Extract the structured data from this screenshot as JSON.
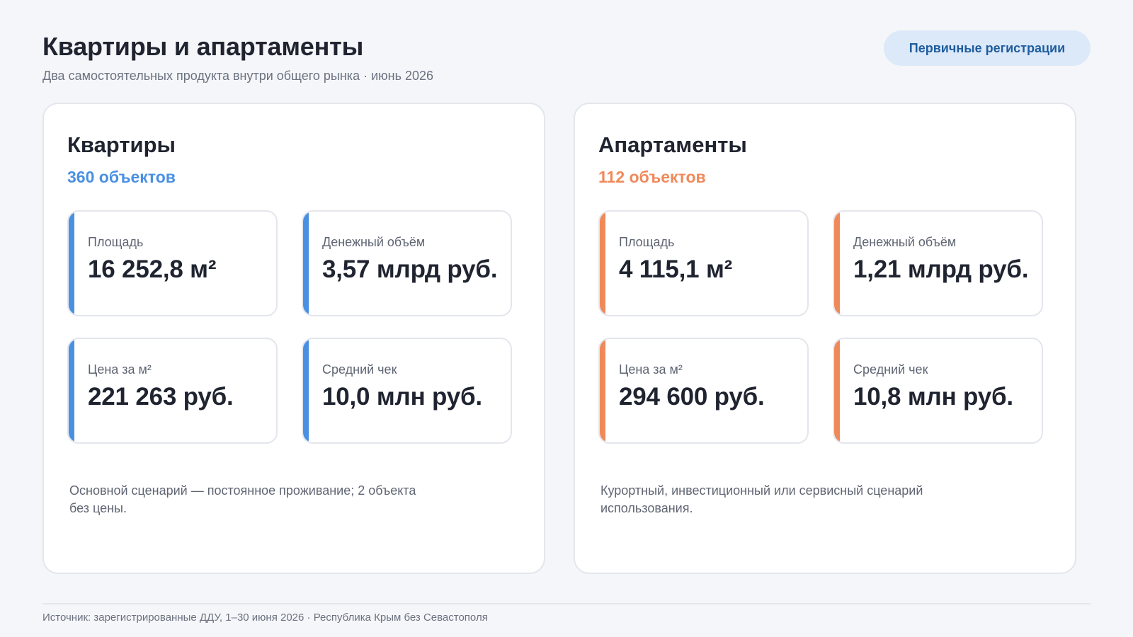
{
  "header": {
    "title": "Квартиры и апартаменты",
    "subtitle": "Два самостоятельных продукта внутри общего рынка · июнь 2026",
    "button_label": "Первичные регистрации"
  },
  "colors": {
    "flats_accent": "#4a90e2",
    "apartments_accent": "#f0895a"
  },
  "panels": {
    "flats": {
      "title": "Квартиры",
      "count": "360 объектов",
      "metrics": [
        {
          "label": "Площадь",
          "value": "16 252,8 м²"
        },
        {
          "label": "Денежный объём",
          "value": "3,57 млрд руб."
        },
        {
          "label": "Цена за м²",
          "value": "221 263 руб."
        },
        {
          "label": "Средний чек",
          "value": "10,0 млн руб."
        }
      ],
      "note": "Основной сценарий — постоянное проживание; 2 объекта без цены."
    },
    "apartments": {
      "title": "Апартаменты",
      "count": "112 объектов",
      "metrics": [
        {
          "label": "Площадь",
          "value": "4 115,1 м²"
        },
        {
          "label": "Денежный объём",
          "value": "1,21 млрд руб."
        },
        {
          "label": "Цена за м²",
          "value": "294 600 руб."
        },
        {
          "label": "Средний чек",
          "value": "10,8 млн руб."
        }
      ],
      "note": "Курортный, инвестиционный или сервисный сценарий использования."
    }
  },
  "footer": {
    "source": "Источник: зарегистрированные ДДУ, 1–30 июня 2026 · Республика Крым без Севастополя"
  }
}
